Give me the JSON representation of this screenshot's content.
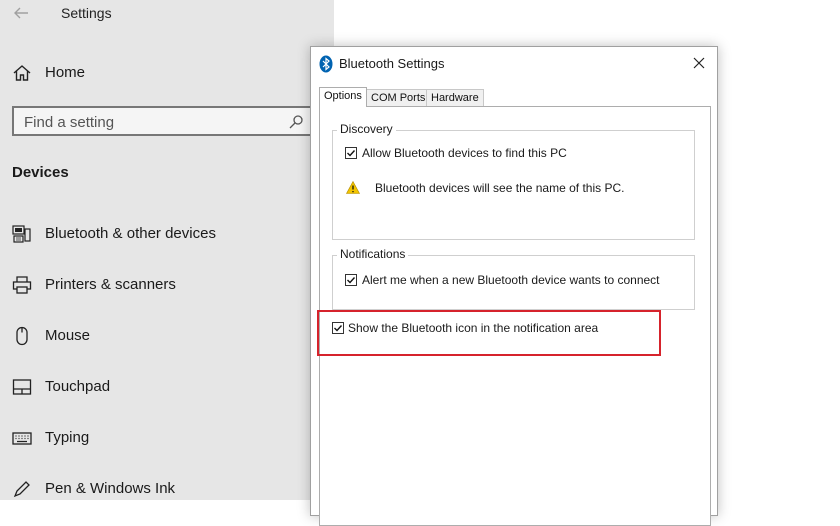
{
  "settings": {
    "title": "Settings",
    "home_label": "Home",
    "search_placeholder": "Find a setting",
    "section_heading": "Devices",
    "nav": [
      {
        "label": "Bluetooth & other devices",
        "icon": "bluetooth-devices-icon"
      },
      {
        "label": "Printers & scanners",
        "icon": "printer-icon"
      },
      {
        "label": "Mouse",
        "icon": "mouse-icon"
      },
      {
        "label": "Touchpad",
        "icon": "touchpad-icon"
      },
      {
        "label": "Typing",
        "icon": "keyboard-icon"
      },
      {
        "label": "Pen & Windows Ink",
        "icon": "pen-icon"
      }
    ]
  },
  "dialog": {
    "title": "Bluetooth Settings",
    "tabs": [
      "Options",
      "COM Ports",
      "Hardware"
    ],
    "active_tab": "Options",
    "discovery": {
      "legend": "Discovery",
      "allow_label": "Allow Bluetooth devices to find this PC",
      "allow_checked": true,
      "warning_text": "Bluetooth devices will see the name of this PC."
    },
    "notifications": {
      "legend": "Notifications",
      "alert_label": "Alert me when a new Bluetooth device wants to connect",
      "alert_checked": true
    },
    "show_icon_label": "Show the Bluetooth icon in the notification area",
    "show_icon_checked": true
  },
  "colors": {
    "sidebar_bg": "#e6e6e6",
    "highlight": "#d6232c",
    "bluetooth_blue": "#0063b1",
    "warning_yellow": "#f2c400"
  }
}
